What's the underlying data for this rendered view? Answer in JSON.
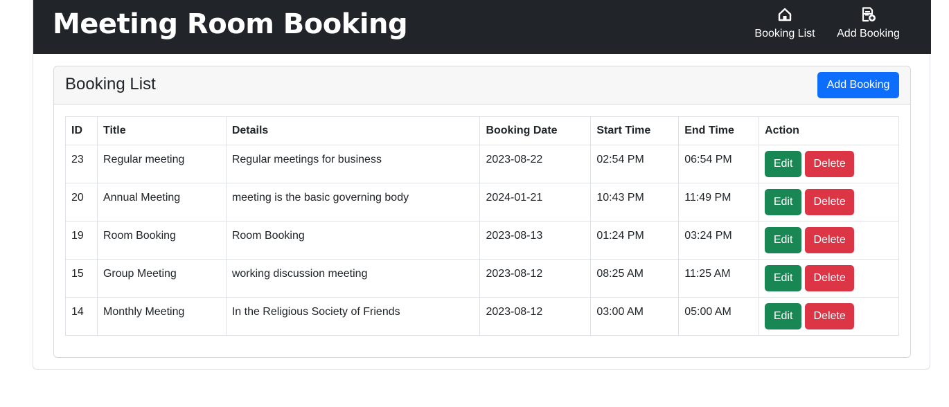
{
  "navbar": {
    "brand": "Meeting Room Booking",
    "links": [
      {
        "label": "Booking List",
        "icon": "house-icon"
      },
      {
        "label": "Add Booking",
        "icon": "document-add-icon"
      }
    ]
  },
  "card": {
    "title": "Booking List",
    "add_button_label": "Add Booking"
  },
  "table": {
    "columns": [
      "ID",
      "Title",
      "Details",
      "Booking Date",
      "Start Time",
      "End Time",
      "Action"
    ],
    "rows": [
      {
        "id": "23",
        "title": "Regular meeting",
        "details": "Regular meetings for business",
        "date": "2023-08-22",
        "start": "02:54 PM",
        "end": "06:54 PM"
      },
      {
        "id": "20",
        "title": "Annual Meeting",
        "details": "meeting is the basic governing body",
        "date": "2024-01-21",
        "start": "10:43 PM",
        "end": "11:49 PM"
      },
      {
        "id": "19",
        "title": "Room Booking",
        "details": "Room Booking",
        "date": "2023-08-13",
        "start": "01:24 PM",
        "end": "03:24 PM"
      },
      {
        "id": "15",
        "title": "Group Meeting",
        "details": "working discussion meeting",
        "date": "2023-08-12",
        "start": "08:25 AM",
        "end": "11:25 AM"
      },
      {
        "id": "14",
        "title": "Monthly Meeting",
        "details": "In the Religious Society of Friends",
        "date": "2023-08-12",
        "start": "03:00 AM",
        "end": "05:00 AM"
      }
    ],
    "edit_label": "Edit",
    "delete_label": "Delete"
  },
  "colors": {
    "navbar_bg": "#212529",
    "primary": "#0d6efd",
    "success": "#198754",
    "danger": "#dc3545",
    "card_header_bg": "#f7f7f7",
    "border": "#dee2e6"
  }
}
